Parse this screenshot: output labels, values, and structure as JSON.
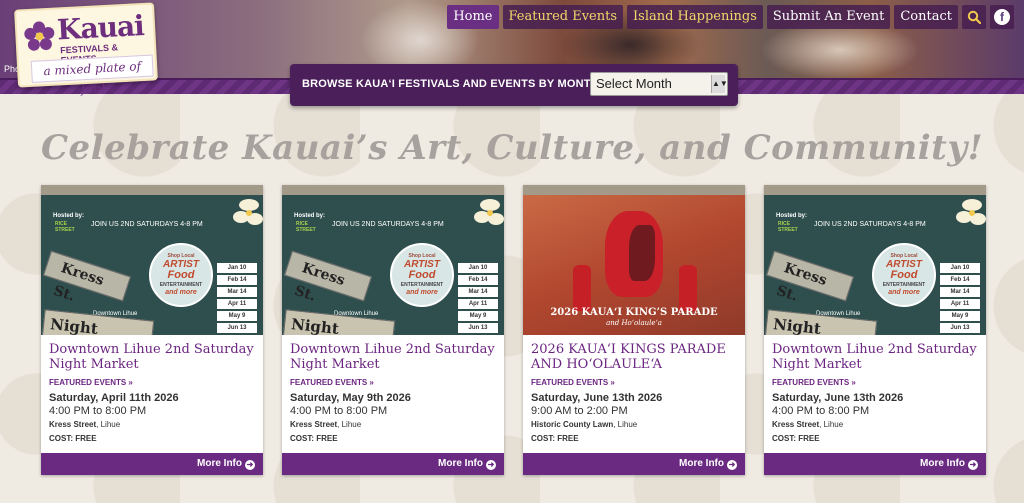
{
  "header": {
    "photo_credit": "Pho",
    "logo": {
      "brand": "Kauai",
      "sub": "FESTIVALS & EVENTS",
      "tagline": "a mixed plate of fun!"
    }
  },
  "nav": {
    "items": [
      {
        "label": "Home"
      },
      {
        "label": "Featured Events"
      },
      {
        "label": "Island Happenings"
      },
      {
        "label": "Submit An Event"
      },
      {
        "label": "Contact"
      }
    ],
    "search_icon": "search-icon",
    "facebook_icon": "f"
  },
  "browse": {
    "label": "BROWSE KAUA‘I FESTIVALS AND EVENTS BY MONTH:",
    "select_value": "Select Month"
  },
  "headline": "Celebrate Kauai’s Art, Culture, and Community!",
  "market_art": {
    "hosted": "Hosted by:",
    "rice": "RICE STREET",
    "join": "JOIN US 2ND SATURDAYS 4-8 PM",
    "shop": "Shop Local",
    "artist": "ARTIST",
    "food": "Food",
    "ent": "ENTERTAINMENT",
    "more": "and more",
    "sign1": "Kress St.",
    "sign2": "Night Market",
    "downtown": "Downtown Lihue",
    "dates": [
      "Jan 10",
      "Feb 14",
      "Mar 14",
      "Apr 11",
      "May 9",
      "Jun 13"
    ]
  },
  "parade_art": {
    "title": "2026 KAUA‘I KING’S PARADE",
    "sub": "and Ho‘olaule‘a"
  },
  "cards": [
    {
      "title": "Downtown Lihue 2nd Saturday Night Market",
      "category": "FEATURED EVENTS »",
      "date": "Saturday, April 11th 2026",
      "time": "4:00 PM to 8:00 PM",
      "venue": "Kress Street",
      "city": ", Lihue",
      "cost": "COST: FREE",
      "more": "More Info"
    },
    {
      "title": "Downtown Lihue 2nd Saturday Night Market",
      "category": "FEATURED EVENTS »",
      "date": "Saturday, May 9th 2026",
      "time": "4:00 PM to 8:00 PM",
      "venue": "Kress Street",
      "city": ", Lihue",
      "cost": "COST: FREE",
      "more": "More Info"
    },
    {
      "title": "2026 KAUA‘I KINGS PARADE AND HO‘OLAULE‘A",
      "category": "FEATURED EVENTS »",
      "date": "Saturday, June 13th 2026",
      "time": "9:00 AM to 2:00 PM",
      "venue": "Historic County Lawn",
      "city": ", Lihue",
      "cost": "COST: FREE",
      "more": "More Info"
    },
    {
      "title": "Downtown Lihue 2nd Saturday Night Market",
      "category": "FEATURED EVENTS »",
      "date": "Saturday, June 13th 2026",
      "time": "4:00 PM to 8:00 PM",
      "venue": "Kress Street",
      "city": ", Lihue",
      "cost": "COST: FREE",
      "more": "More Info"
    }
  ]
}
